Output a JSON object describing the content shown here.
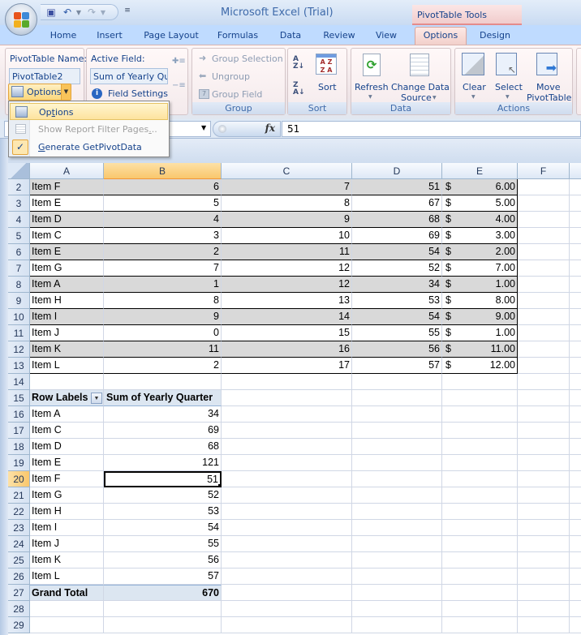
{
  "app": {
    "title": "Microsoft Excel (Trial)",
    "context_tab_group": "PivotTable Tools"
  },
  "quick_access": {
    "icons": [
      "save-icon",
      "undo-icon",
      "redo-icon",
      "customize-icon"
    ]
  },
  "tabs": [
    {
      "label": "Home",
      "active": false
    },
    {
      "label": "Insert",
      "active": false
    },
    {
      "label": "Page Layout",
      "active": false
    },
    {
      "label": "Formulas",
      "active": false
    },
    {
      "label": "Data",
      "active": false
    },
    {
      "label": "Review",
      "active": false
    },
    {
      "label": "View",
      "active": false
    },
    {
      "label": "Options",
      "active": true
    },
    {
      "label": "Design",
      "active": false
    }
  ],
  "ribbon": {
    "pivottable": {
      "name_label": "PivotTable Name:",
      "name_value": "PivotTable2",
      "options_label": "Options"
    },
    "active_field": {
      "label": "Active Field:",
      "value": "Sum of Yearly Qua",
      "field_settings": "Field Settings"
    },
    "group": {
      "label": "Group",
      "group_selection": "Group Selection",
      "ungroup": "Ungroup",
      "group_field": "Group Field"
    },
    "sort": {
      "label": "Sort",
      "sort_button": "Sort"
    },
    "data": {
      "label": "Data",
      "refresh": "Refresh",
      "change_source_1": "Change Data",
      "change_source_2": "Source"
    },
    "actions": {
      "label": "Actions",
      "clear": "Clear",
      "select": "Select",
      "move_1": "Move",
      "move_2": "PivotTable"
    }
  },
  "options_menu": {
    "items": [
      {
        "label": "Options",
        "state": "highlighted"
      },
      {
        "label": "Show Report Filter Pages...",
        "state": "disabled"
      },
      {
        "label": "Generate GetPivotData",
        "state": "checked"
      }
    ]
  },
  "formula_bar": {
    "name_box": "",
    "fx_label": "fx",
    "value": "51"
  },
  "sheet": {
    "columns": [
      "A",
      "B",
      "C",
      "D",
      "E",
      "F"
    ],
    "selected_column": "B",
    "selected_row": "20",
    "source_table": [
      {
        "row": "2",
        "a": "Item F",
        "b": "6",
        "c": "7",
        "d": "51",
        "cur": "$",
        "e": "6.00"
      },
      {
        "row": "3",
        "a": "Item E",
        "b": "5",
        "c": "8",
        "d": "67",
        "cur": "$",
        "e": "5.00"
      },
      {
        "row": "4",
        "a": "Item D",
        "b": "4",
        "c": "9",
        "d": "68",
        "cur": "$",
        "e": "4.00"
      },
      {
        "row": "5",
        "a": "Item C",
        "b": "3",
        "c": "10",
        "d": "69",
        "cur": "$",
        "e": "3.00"
      },
      {
        "row": "6",
        "a": "Item E",
        "b": "2",
        "c": "11",
        "d": "54",
        "cur": "$",
        "e": "2.00"
      },
      {
        "row": "7",
        "a": "Item G",
        "b": "7",
        "c": "12",
        "d": "52",
        "cur": "$",
        "e": "7.00"
      },
      {
        "row": "8",
        "a": "Item A",
        "b": "1",
        "c": "12",
        "d": "34",
        "cur": "$",
        "e": "1.00"
      },
      {
        "row": "9",
        "a": "Item H",
        "b": "8",
        "c": "13",
        "d": "53",
        "cur": "$",
        "e": "8.00"
      },
      {
        "row": "10",
        "a": "Item I",
        "b": "9",
        "c": "14",
        "d": "54",
        "cur": "$",
        "e": "9.00"
      },
      {
        "row": "11",
        "a": "Item J",
        "b": "0",
        "c": "15",
        "d": "55",
        "cur": "$",
        "e": "1.00"
      },
      {
        "row": "12",
        "a": "Item K",
        "b": "11",
        "c": "16",
        "d": "56",
        "cur": "$",
        "e": "11.00"
      },
      {
        "row": "13",
        "a": "Item L",
        "b": "2",
        "c": "17",
        "d": "57",
        "cur": "$",
        "e": "12.00"
      }
    ],
    "empty_row_14": "14",
    "pivot": {
      "header_row": "15",
      "row_labels": "Row Labels",
      "value_header": "Sum of Yearly Quarter",
      "rows": [
        {
          "row": "16",
          "label": "Item A",
          "value": "34"
        },
        {
          "row": "17",
          "label": "Item C",
          "value": "69"
        },
        {
          "row": "18",
          "label": "Item D",
          "value": "68"
        },
        {
          "row": "19",
          "label": "Item E",
          "value": "121"
        },
        {
          "row": "20",
          "label": "Item F",
          "value": "51"
        },
        {
          "row": "21",
          "label": "Item G",
          "value": "52"
        },
        {
          "row": "22",
          "label": "Item H",
          "value": "53"
        },
        {
          "row": "23",
          "label": "Item I",
          "value": "54"
        },
        {
          "row": "24",
          "label": "Item J",
          "value": "55"
        },
        {
          "row": "25",
          "label": "Item K",
          "value": "56"
        },
        {
          "row": "26",
          "label": "Item L",
          "value": "57"
        }
      ],
      "total_row": "27",
      "total_label": "Grand Total",
      "total_value": "670"
    },
    "trailing_rows": [
      "28",
      "29"
    ]
  }
}
